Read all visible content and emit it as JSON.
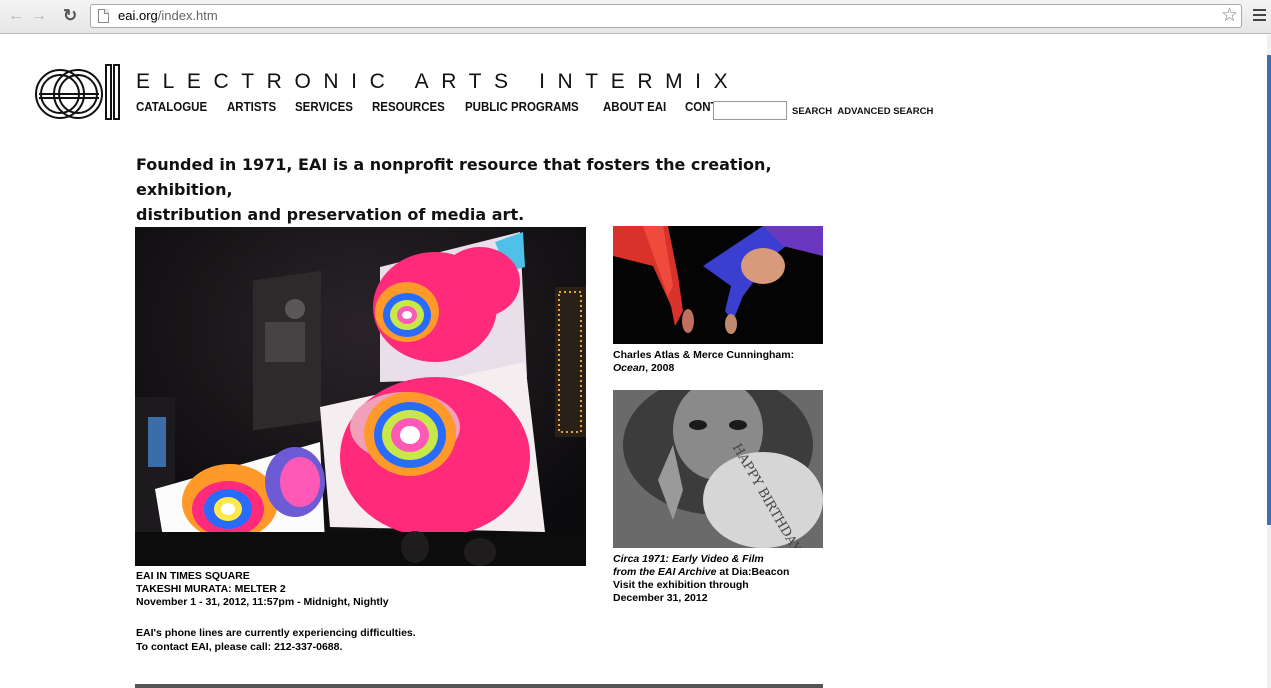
{
  "browser": {
    "url_domain": "eai.org",
    "url_path": "/index.htm",
    "icons": [
      "back-icon",
      "forward-icon",
      "reload-icon",
      "page-icon",
      "star-icon",
      "menu-icon"
    ]
  },
  "header": {
    "logo_text": "eai",
    "title": "ELECTRONIC ARTS INTERMIX",
    "nav": [
      "CATALOGUE",
      "ARTISTS",
      "SERVICES",
      "RESOURCES",
      "PUBLIC PROGRAMS",
      "ABOUT EAI",
      "CONTACT"
    ],
    "search_value": "",
    "search_label": "SEARCH",
    "advanced_search_label": "ADVANCED SEARCH"
  },
  "intro": {
    "line1": "Founded in 1971, EAI is a nonprofit resource that fosters the creation, exhibition,",
    "line2": "distribution and preservation of media art."
  },
  "feature": {
    "caption_line1": "EAI IN TIMES SQUARE",
    "caption_line2": "TAKESHI MURATA: MELTER 2",
    "caption_line3": "November 1 - 31, 2012, 11:57pm - Midnight, Nightly"
  },
  "notice": {
    "line1": "EAI's phone lines are currently experiencing difficulties.",
    "line2": "To contact EAI, please call: 212-337-0688."
  },
  "side1": {
    "caption_line1": "Charles Atlas & Merce Cunningham:",
    "caption_title": "Ocean",
    "caption_rest": ", 2008"
  },
  "side2": {
    "caption_line1": "Circa 1971: Early Video & Film",
    "caption_line2_italic": "from the EAI Archive",
    "caption_line2_rest": " at Dia:Beacon",
    "caption_line3": "Visit the exhibition through",
    "caption_line4": "December 31, 2012",
    "balloon_text": "HAPPY BIRTHDAY"
  },
  "colors": {
    "accent_blue": "#3f6fb8",
    "pink": "#ff2a7a",
    "text": "#111111"
  }
}
